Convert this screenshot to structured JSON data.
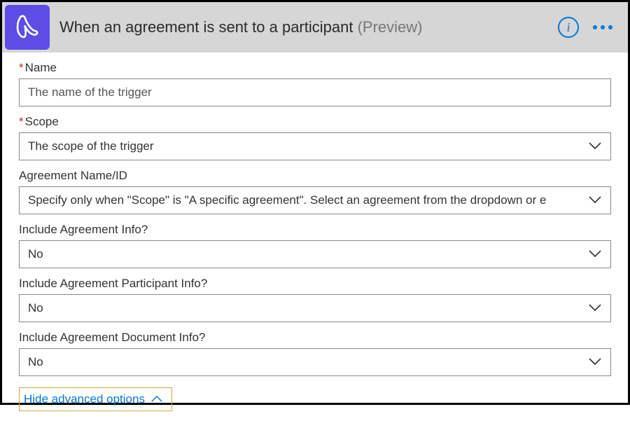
{
  "header": {
    "title": "When an agreement is sent to a participant",
    "suffix": "(Preview)"
  },
  "fields": {
    "name": {
      "label": "Name",
      "required": true,
      "placeholder": "The name of the trigger"
    },
    "scope": {
      "label": "Scope",
      "required": true,
      "placeholder": "The scope of the trigger"
    },
    "agreement_id": {
      "label": "Agreement Name/ID",
      "required": false,
      "placeholder": "Specify only when \"Scope\" is \"A specific agreement\". Select an agreement from the dropdown or e"
    },
    "include_info": {
      "label": "Include Agreement Info?",
      "required": false,
      "value": "No"
    },
    "include_participant": {
      "label": "Include Agreement Participant Info?",
      "required": false,
      "value": "No"
    },
    "include_document": {
      "label": "Include Agreement Document Info?",
      "required": false,
      "value": "No"
    }
  },
  "advanced_toggle": "Hide advanced options"
}
